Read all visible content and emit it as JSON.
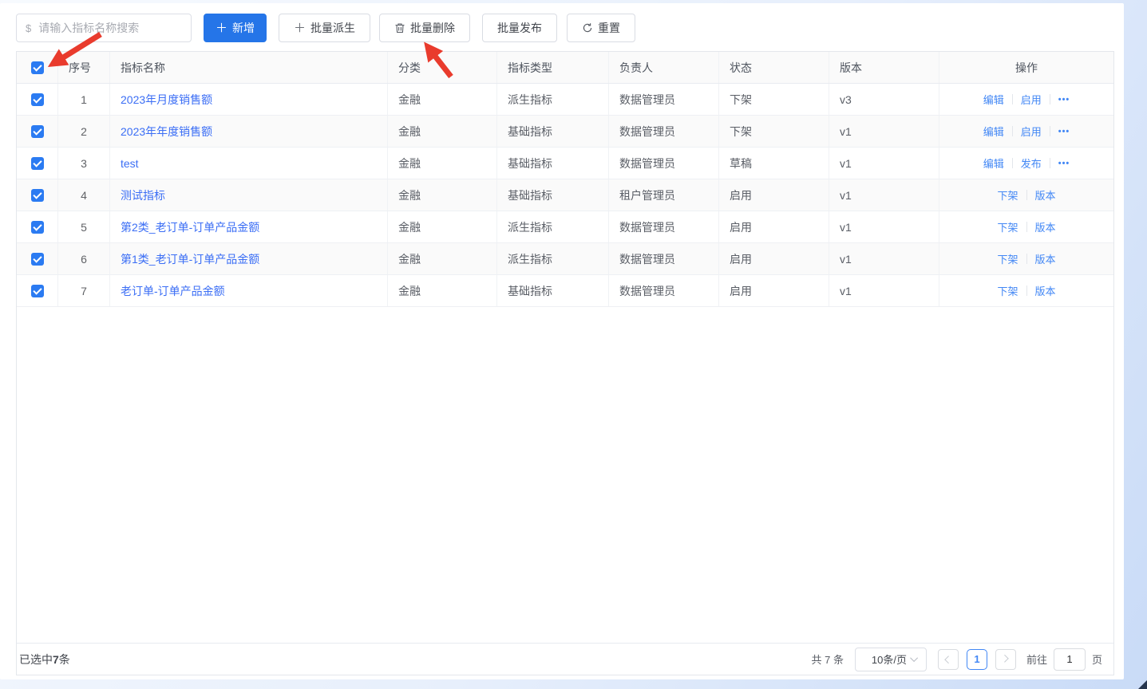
{
  "colors": {
    "primary": "#2575e8",
    "checkbox": "#2b7bf2",
    "name_link": "#3b6ef5",
    "action_link": "#4287f5",
    "annotation_arrow": "#e93b2d",
    "stripe_row": "#fafafa",
    "table_border": "#e4e7ec"
  },
  "toolbar": {
    "search": {
      "prefix_icon": "$",
      "placeholder": "请输入指标名称搜索"
    },
    "add_button": "新增",
    "batch_derive_button": "批量派生",
    "batch_delete_button": "批量删除",
    "batch_publish_button": "批量发布",
    "reset_button": "重置"
  },
  "table": {
    "columns": [
      "序号",
      "指标名称",
      "分类",
      "指标类型",
      "负责人",
      "状态",
      "版本",
      "操作"
    ],
    "rows": [
      {
        "no": "1",
        "name": "2023年月度销售额",
        "category": "金融",
        "type": "派生指标",
        "owner": "数据管理员",
        "status": "下架",
        "version": "v3",
        "actions": [
          "编辑",
          "启用"
        ],
        "more": true
      },
      {
        "no": "2",
        "name": "2023年年度销售额",
        "category": "金融",
        "type": "基础指标",
        "owner": "数据管理员",
        "status": "下架",
        "version": "v1",
        "actions": [
          "编辑",
          "启用"
        ],
        "more": true
      },
      {
        "no": "3",
        "name": "test",
        "category": "金融",
        "type": "基础指标",
        "owner": "数据管理员",
        "status": "草稿",
        "version": "v1",
        "actions": [
          "编辑",
          "发布"
        ],
        "more": true
      },
      {
        "no": "4",
        "name": "测试指标",
        "category": "金融",
        "type": "基础指标",
        "owner": "租户管理员",
        "status": "启用",
        "version": "v1",
        "actions": [
          "下架",
          "版本"
        ],
        "more": false
      },
      {
        "no": "5",
        "name": "第2类_老订单-订单产品金额",
        "category": "金融",
        "type": "派生指标",
        "owner": "数据管理员",
        "status": "启用",
        "version": "v1",
        "actions": [
          "下架",
          "版本"
        ],
        "more": false
      },
      {
        "no": "6",
        "name": "第1类_老订单-订单产品金额",
        "category": "金融",
        "type": "派生指标",
        "owner": "数据管理员",
        "status": "启用",
        "version": "v1",
        "actions": [
          "下架",
          "版本"
        ],
        "more": false
      },
      {
        "no": "7",
        "name": "老订单-订单产品金额",
        "category": "金融",
        "type": "基础指标",
        "owner": "数据管理员",
        "status": "启用",
        "version": "v1",
        "actions": [
          "下架",
          "版本"
        ],
        "more": false
      }
    ],
    "more_icon": "•••"
  },
  "footer": {
    "selected_prefix": "已选中",
    "selected_count": "7",
    "selected_suffix": "条",
    "total_text": "共 7 条",
    "page_size_text": "10条/页",
    "current_page": "1",
    "goto_label": "前往",
    "goto_value": "1",
    "goto_unit": "页"
  }
}
